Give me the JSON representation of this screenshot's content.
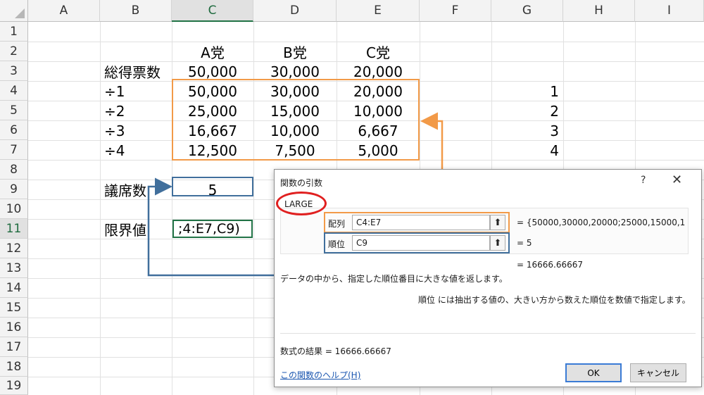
{
  "sheet": {
    "columns": [
      "A",
      "B",
      "C",
      "D",
      "E",
      "F",
      "G",
      "H",
      "I"
    ],
    "rows": [
      "1",
      "2",
      "3",
      "4",
      "5",
      "6",
      "7",
      "8",
      "9",
      "10",
      "11",
      "12",
      "13",
      "14",
      "15",
      "16",
      "17",
      "18",
      "19"
    ],
    "party_headers": [
      "A党",
      "B党",
      "C党"
    ],
    "total_label": "総得票数",
    "totals": [
      "50,000",
      "30,000",
      "20,000"
    ],
    "divisors": [
      {
        "label": "÷1",
        "values": [
          "50,000",
          "30,000",
          "20,000"
        ],
        "rank": "1"
      },
      {
        "label": "÷2",
        "values": [
          "25,000",
          "15,000",
          "10,000"
        ],
        "rank": "2"
      },
      {
        "label": "÷3",
        "values": [
          "16,667",
          "10,000",
          "6,667"
        ],
        "rank": "3"
      },
      {
        "label": "÷4",
        "values": [
          "12,500",
          "7,500",
          "5,000"
        ],
        "rank": "4"
      }
    ],
    "seats_label": "議席数",
    "seats_value": "5",
    "limit_label": "限界値",
    "limit_formula": ";4:E7,C9)"
  },
  "dialog": {
    "title": "関数の引数",
    "help_q": "?",
    "close": "✕",
    "function_name": "LARGE",
    "arg1_label": "配列",
    "arg1_input": "C4:E7",
    "arg1_value": "=  {50000,30000,20000;25000,15000,1",
    "arg2_label": "順位",
    "arg2_input": "C9",
    "arg2_value": "=  5",
    "result_line": "=  16666.66667",
    "description": "データの中から、指定した順位番目に大きな値を返します。",
    "arg_description": "順位   には抽出する値の、大きい方から数えた順位を数値で指定します。",
    "formula_result": "数式の結果 =   16666.66667",
    "help_link": "この関数のヘルプ(H)",
    "ok": "OK",
    "cancel": "キャンセル"
  },
  "colors": {
    "orange": "#f29a48",
    "blue": "#416f9c",
    "red": "#e02020",
    "excel_green": "#217346"
  }
}
